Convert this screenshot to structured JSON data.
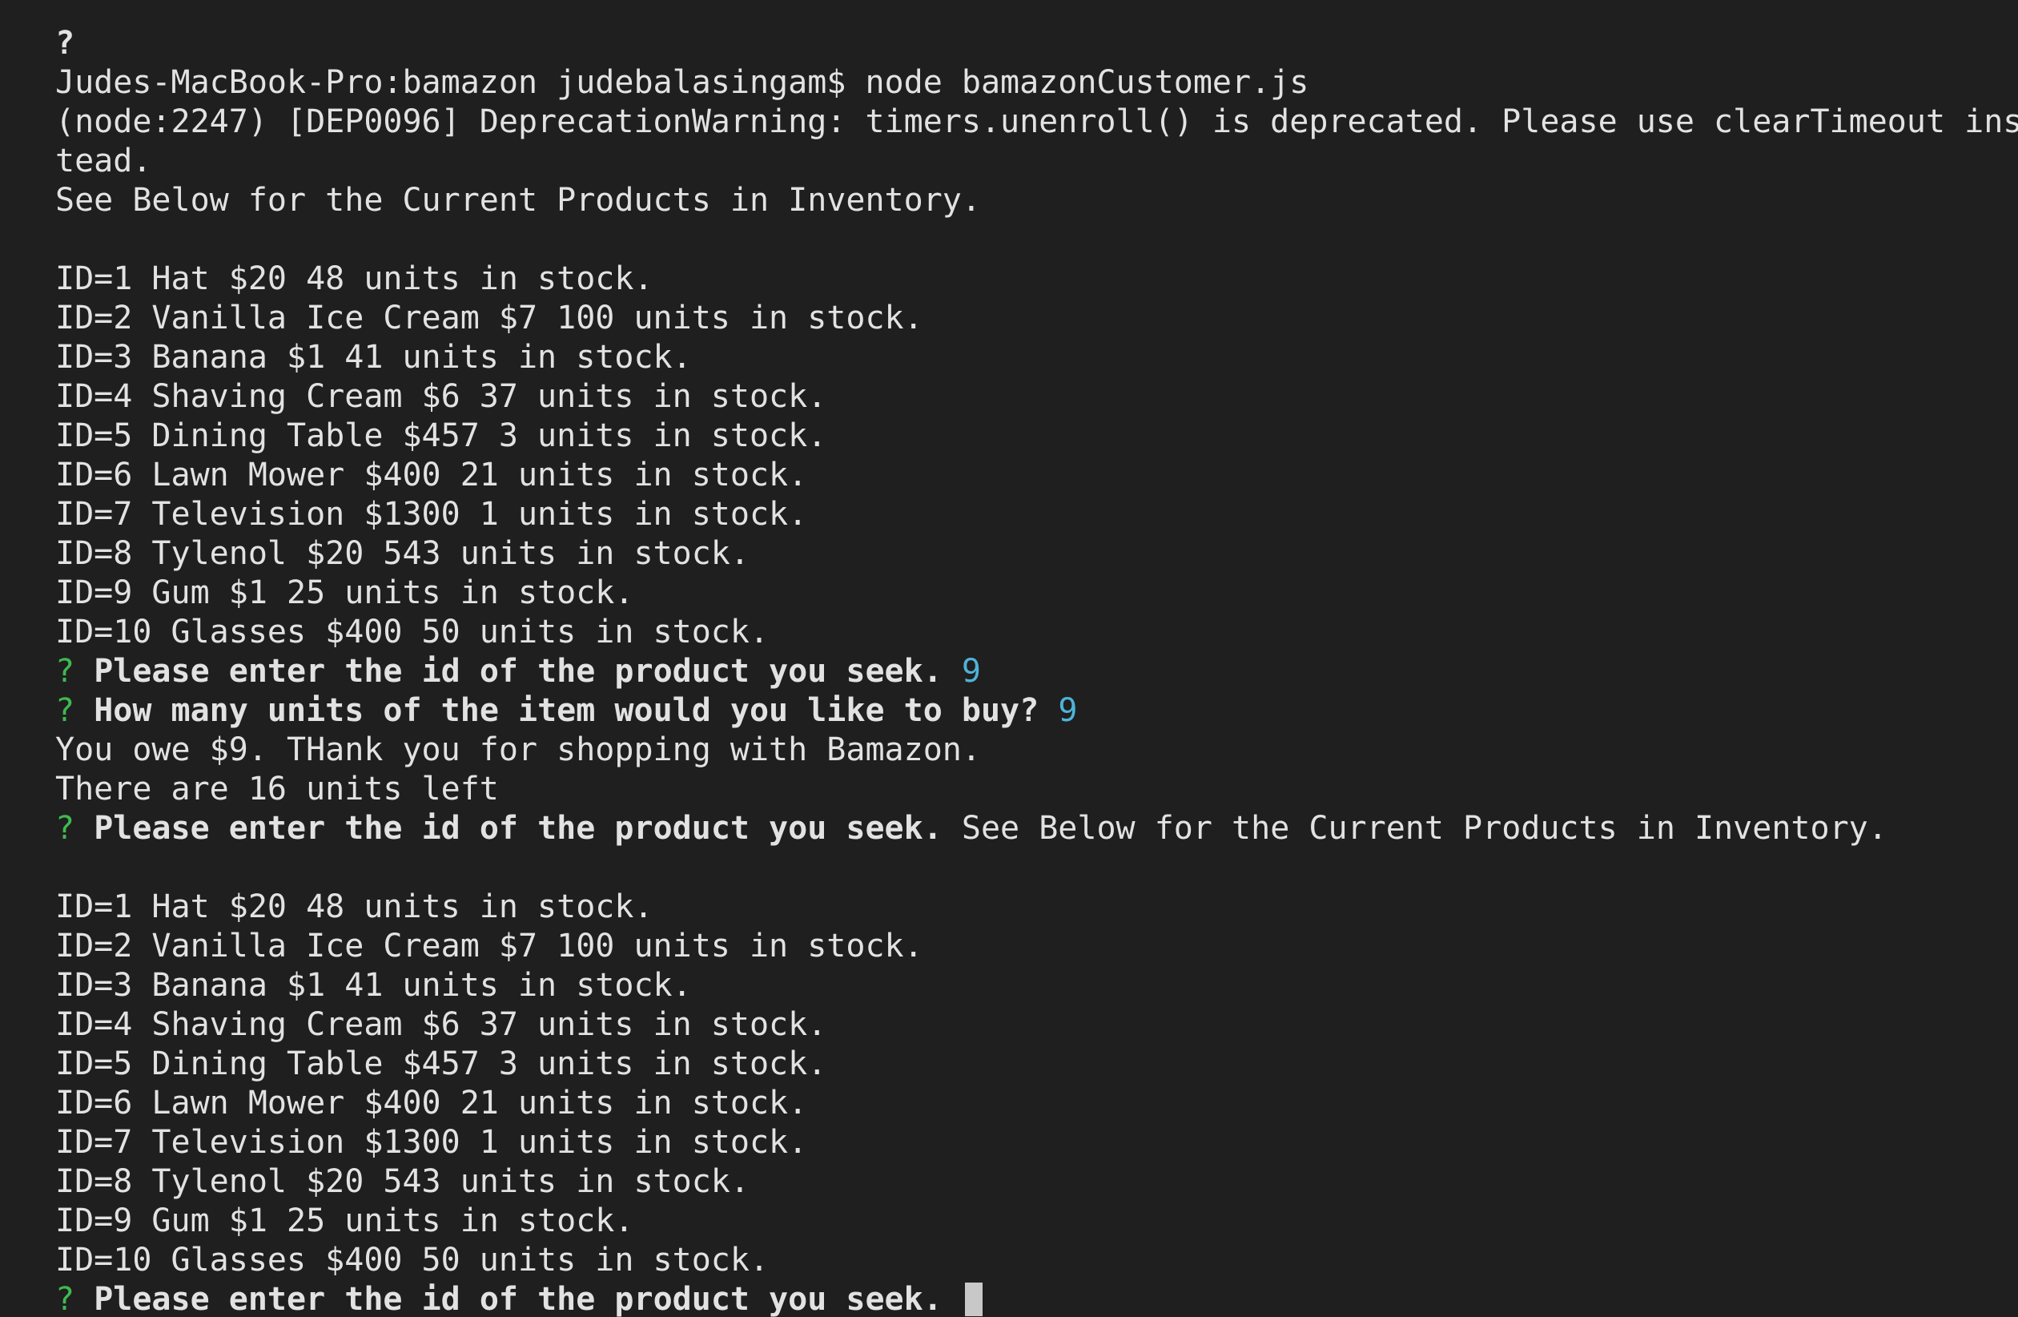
{
  "theme": {
    "background": "#1f1f1f",
    "text": "#e2e2e2",
    "prompt_marker": "#3fb950",
    "answer": "#4fb3d9",
    "cursor": "#c8c8c8"
  },
  "lines": [
    {
      "kind": "text",
      "bold": true,
      "text": "?"
    },
    {
      "kind": "text",
      "text": "Judes-MacBook-Pro:bamazon judebalasingam$ node bamazonCustomer.js"
    },
    {
      "kind": "text",
      "text": "(node:2247) [DEP0096] DeprecationWarning: timers.unenroll() is deprecated. Please use clearTimeout ins"
    },
    {
      "kind": "text",
      "text": "tead."
    },
    {
      "kind": "text",
      "text": "See Below for the Current Products in Inventory."
    },
    {
      "kind": "text",
      "text": ""
    },
    {
      "kind": "text",
      "text": "ID=1 Hat $20 48 units in stock."
    },
    {
      "kind": "text",
      "text": "ID=2 Vanilla Ice Cream $7 100 units in stock."
    },
    {
      "kind": "text",
      "text": "ID=3 Banana $1 41 units in stock."
    },
    {
      "kind": "text",
      "text": "ID=4 Shaving Cream $6 37 units in stock."
    },
    {
      "kind": "text",
      "text": "ID=5 Dining Table $457 3 units in stock."
    },
    {
      "kind": "text",
      "text": "ID=6 Lawn Mower $400 21 units in stock."
    },
    {
      "kind": "text",
      "text": "ID=7 Television $1300 1 units in stock."
    },
    {
      "kind": "text",
      "text": "ID=8 Tylenol $20 543 units in stock."
    },
    {
      "kind": "text",
      "text": "ID=9 Gum $1 25 units in stock."
    },
    {
      "kind": "text",
      "text": "ID=10 Glasses $400 50 units in stock."
    },
    {
      "kind": "prompt",
      "marker": "?",
      "question": "Please enter the id of the product you seek.",
      "answer": "9"
    },
    {
      "kind": "prompt",
      "marker": "?",
      "question": "How many units of the item would you like to buy?",
      "answer": "9"
    },
    {
      "kind": "text",
      "text": "You owe $9. THank you for shopping with Bamazon."
    },
    {
      "kind": "text",
      "text": "There are 16 units left"
    },
    {
      "kind": "prompt",
      "marker": "?",
      "question": "Please enter the id of the product you seek.",
      "rest": "See Below for the Current Products in Inventory."
    },
    {
      "kind": "text",
      "text": ""
    },
    {
      "kind": "text",
      "text": "ID=1 Hat $20 48 units in stock."
    },
    {
      "kind": "text",
      "text": "ID=2 Vanilla Ice Cream $7 100 units in stock."
    },
    {
      "kind": "text",
      "text": "ID=3 Banana $1 41 units in stock."
    },
    {
      "kind": "text",
      "text": "ID=4 Shaving Cream $6 37 units in stock."
    },
    {
      "kind": "text",
      "text": "ID=5 Dining Table $457 3 units in stock."
    },
    {
      "kind": "text",
      "text": "ID=6 Lawn Mower $400 21 units in stock."
    },
    {
      "kind": "text",
      "text": "ID=7 Television $1300 1 units in stock."
    },
    {
      "kind": "text",
      "text": "ID=8 Tylenol $20 543 units in stock."
    },
    {
      "kind": "text",
      "text": "ID=9 Gum $1 25 units in stock."
    },
    {
      "kind": "text",
      "text": "ID=10 Glasses $400 50 units in stock."
    },
    {
      "kind": "prompt",
      "marker": "?",
      "question": "Please enter the id of the product you seek.",
      "cursor": true
    }
  ]
}
